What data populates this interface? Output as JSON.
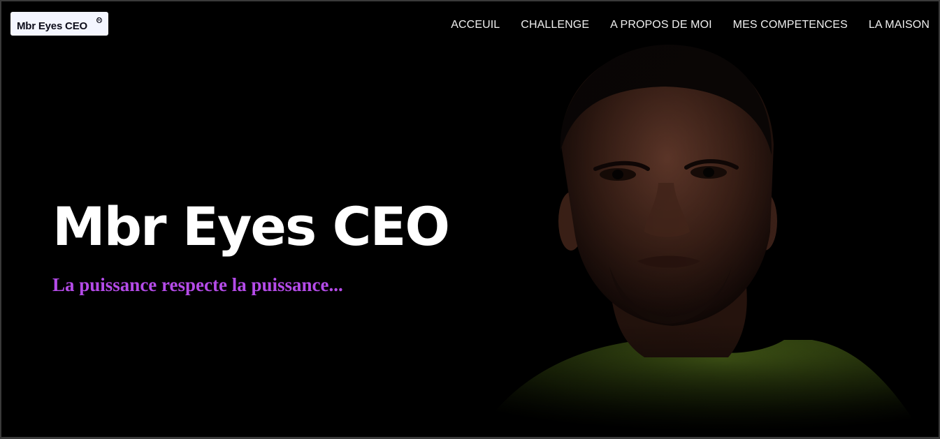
{
  "brand": {
    "logo_text": "Mbr Eyes CEO",
    "registered_mark": "R"
  },
  "nav": {
    "items": [
      {
        "label": "ACCEUIL"
      },
      {
        "label": "CHALLENGE"
      },
      {
        "label": "A PROPOS DE MOI"
      },
      {
        "label": "MES COMPETENCES"
      },
      {
        "label": "LA MAISON"
      }
    ]
  },
  "hero": {
    "title": "Mbr Eyes CEO",
    "subtitle": "La puissance respecte la puissance...",
    "subtitle_color": "#b44be8",
    "background_color": "#000000"
  }
}
